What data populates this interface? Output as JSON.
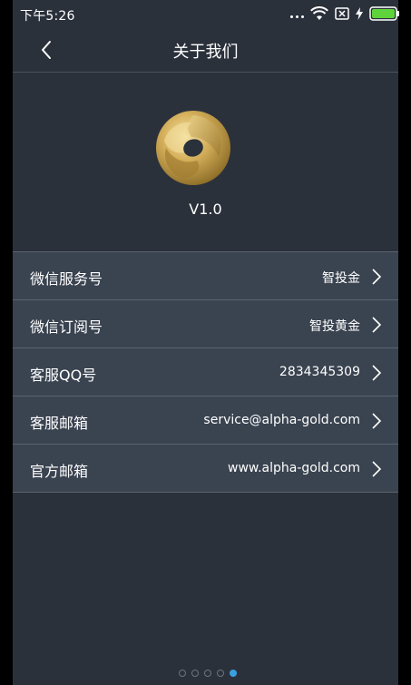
{
  "status_bar": {
    "time": "下午5:26"
  },
  "header": {
    "title": "关于我们"
  },
  "app": {
    "version": "V1.0"
  },
  "info_rows": [
    {
      "label": "微信服务号",
      "value": "智投金"
    },
    {
      "label": "微信订阅号",
      "value": "智投黄金"
    },
    {
      "label": "客服QQ号",
      "value": "2834345309"
    },
    {
      "label": "客服邮箱",
      "value": "service@alpha-gold.com"
    },
    {
      "label": "官方邮箱",
      "value": "www.alpha-gold.com"
    }
  ],
  "page_indicator": {
    "count": 5,
    "active_index": 4
  },
  "colors": {
    "background": "#2b313b",
    "row_background": "#3a4350",
    "divider": "#5a6370",
    "battery": "#5fd33a",
    "indicator_active": "#3aa0e0",
    "logo_gold": "#c9a54c"
  }
}
